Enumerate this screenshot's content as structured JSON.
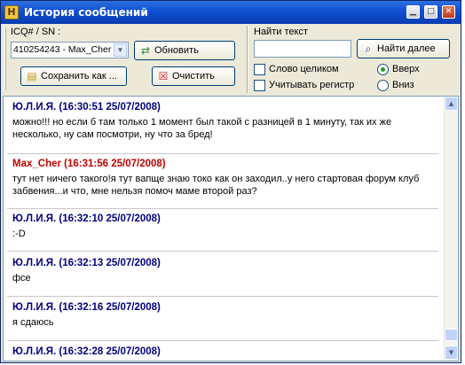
{
  "window": {
    "title": "История сообщений",
    "app_icon": "H",
    "buttons": {
      "minimize": "▁",
      "maximize": "□",
      "close": "✕"
    }
  },
  "toolbar": {
    "contact_label": "ICQ# / SN :",
    "contact_value": "410254243 - Max_Cher",
    "refresh_label": "Обновить",
    "save_label": "Сохранить как ...",
    "clear_label": "Очистить",
    "search_label": "Найти текст",
    "search_value": "",
    "find_next_label": "Найти далее",
    "whole_word_label": "Слово целиком",
    "whole_word_checked": false,
    "match_case_label": "Учитывать регистр",
    "match_case_checked": false,
    "direction_up_label": "Вверх",
    "direction_down_label": "Вниз",
    "direction_selected": "up"
  },
  "colors": {
    "self": "#000080",
    "contact": "#c00000",
    "title_bar": "#0f4fd2"
  },
  "messages": [
    {
      "author": "self",
      "header": "Ю.Л.И.Я. (16:30:51 25/07/2008)",
      "text": "можно!!! но если б там только 1 момент был такой с разницей в 1 минуту, так их же несколько, ну сам посмотри, ну что за бред!"
    },
    {
      "author": "contact",
      "header": "Max_Cher (16:31:56 25/07/2008)",
      "text": "тут нет ничего такого!я тут вапще знаю токо как он заходил..у него стартовая форум клуб забвения...и что, мне нельзя помоч маме второй раз?"
    },
    {
      "author": "self",
      "header": "Ю.Л.И.Я. (16:32:10 25/07/2008)",
      "text": ":-D"
    },
    {
      "author": "self",
      "header": "Ю.Л.И.Я. (16:32:13 25/07/2008)",
      "text": "фсе"
    },
    {
      "author": "self",
      "header": "Ю.Л.И.Я. (16:32:16 25/07/2008)",
      "text": "я сдаюсь"
    },
    {
      "author": "self",
      "header": "Ю.Л.И.Я. (16:32:28 25/07/2008)",
      "text": ""
    }
  ],
  "icons": {
    "refresh": "refresh-arrows-icon",
    "save": "save-document-icon",
    "clear": "clear-x-icon",
    "find": "find-binoculars-icon"
  }
}
